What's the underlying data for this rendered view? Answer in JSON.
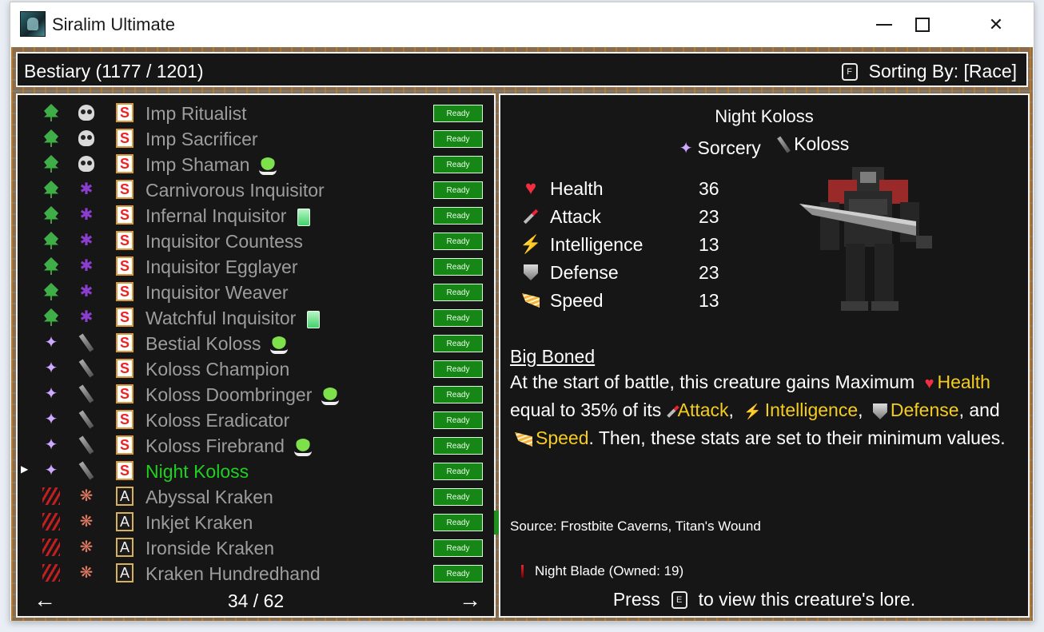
{
  "window": {
    "title": "Siralim Ultimate",
    "controls": {
      "minimize": "—",
      "maximize": "",
      "close": "✕"
    }
  },
  "header": {
    "bestiary_label": "Bestiary (1177 / 1201)",
    "sort_key": "F",
    "sort_label": "Sorting By: [Race]"
  },
  "list": {
    "ready_label": "Ready",
    "items": [
      {
        "name": "Imp Ritualist",
        "class_letter": "S",
        "selected": false,
        "badge": ""
      },
      {
        "name": "Imp Sacrificer",
        "class_letter": "S",
        "selected": false,
        "badge": ""
      },
      {
        "name": "Imp Shaman",
        "class_letter": "S",
        "selected": false,
        "badge": "slime"
      },
      {
        "name": "Carnivorous Inquisitor",
        "class_letter": "S",
        "selected": false,
        "badge": ""
      },
      {
        "name": "Infernal Inquisitor",
        "class_letter": "S",
        "selected": false,
        "badge": "card"
      },
      {
        "name": "Inquisitor Countess",
        "class_letter": "S",
        "selected": false,
        "badge": ""
      },
      {
        "name": "Inquisitor Egglayer",
        "class_letter": "S",
        "selected": false,
        "badge": ""
      },
      {
        "name": "Inquisitor Weaver",
        "class_letter": "S",
        "selected": false,
        "badge": ""
      },
      {
        "name": "Watchful Inquisitor",
        "class_letter": "S",
        "selected": false,
        "badge": "card"
      },
      {
        "name": "Bestial Koloss",
        "class_letter": "S",
        "selected": false,
        "badge": "slime"
      },
      {
        "name": "Koloss Champion",
        "class_letter": "S",
        "selected": false,
        "badge": ""
      },
      {
        "name": "Koloss Doombringer",
        "class_letter": "S",
        "selected": false,
        "badge": "slime"
      },
      {
        "name": "Koloss Eradicator",
        "class_letter": "S",
        "selected": false,
        "badge": ""
      },
      {
        "name": "Koloss Firebrand",
        "class_letter": "S",
        "selected": false,
        "badge": "slime"
      },
      {
        "name": "Night Koloss",
        "class_letter": "S",
        "selected": true,
        "badge": ""
      },
      {
        "name": "Abyssal Kraken",
        "class_letter": "A",
        "selected": false,
        "badge": ""
      },
      {
        "name": "Inkjet Kraken",
        "class_letter": "A",
        "selected": false,
        "badge": ""
      },
      {
        "name": "Ironside Kraken",
        "class_letter": "A",
        "selected": false,
        "badge": ""
      },
      {
        "name": "Kraken Hundredhand",
        "class_letter": "A",
        "selected": false,
        "badge": ""
      }
    ],
    "pager": {
      "prev": "←",
      "count": "34 / 62",
      "next": "→"
    }
  },
  "detail": {
    "name": "Night Koloss",
    "class": "Sorcery",
    "race": "Koloss",
    "stats": [
      {
        "label": "Health",
        "value": "36",
        "icon": "heart-icon"
      },
      {
        "label": "Attack",
        "value": "23",
        "icon": "sword-icon"
      },
      {
        "label": "Intelligence",
        "value": "13",
        "icon": "bolt-icon"
      },
      {
        "label": "Defense",
        "value": "23",
        "icon": "shield-icon"
      },
      {
        "label": "Speed",
        "value": "13",
        "icon": "wing-icon"
      }
    ],
    "trait": {
      "name": "Big Boned",
      "desc_1": "At the start of battle, this creature gains Maximum",
      "w_health": "Health",
      "desc_2": "equal to 35% of its",
      "w_attack": "Attack",
      "sep_1": ",",
      "w_intelligence": "Intelligence",
      "sep_2": ",",
      "w_defense": "Defense",
      "sep_3": ",",
      "desc_3": "and",
      "w_speed": "Speed",
      "desc_4": ". Then, these stats are set to their minimum values."
    },
    "source": "Source: Frostbite Caverns, Titan's Wound",
    "item": "Night Blade (Owned: 19)",
    "lore_press": "Press",
    "lore_key": "E",
    "lore_text": "to view this creature's lore."
  },
  "colors": {
    "selected_name": "#20d020",
    "ready_bg": "#168716",
    "highlight": "#f5cc20"
  }
}
